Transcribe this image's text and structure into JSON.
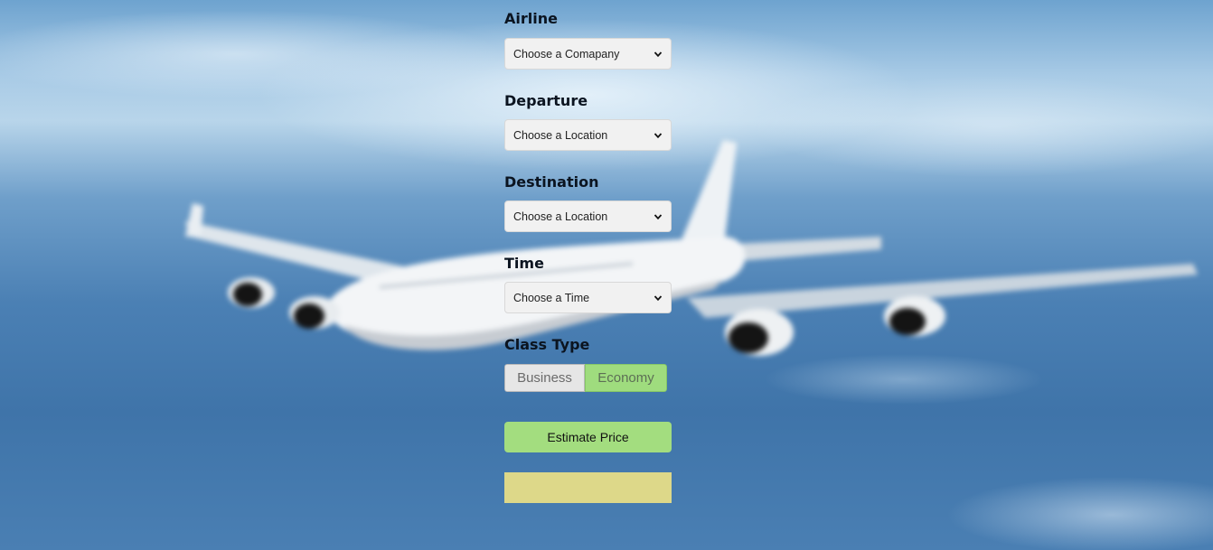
{
  "form": {
    "airline": {
      "label": "Airline",
      "selected": "Choose a Comapany"
    },
    "departure": {
      "label": "Departure",
      "selected": "Choose a Location"
    },
    "destination": {
      "label": "Destination",
      "selected": "Choose a Location"
    },
    "time": {
      "label": "Time",
      "selected": "Choose a Time"
    },
    "class_type": {
      "label": "Class Type",
      "options": [
        "Business",
        "Economy"
      ],
      "selected": "Economy"
    },
    "estimate_button_label": "Estimate Price",
    "result_text": ""
  },
  "colors": {
    "selected_class": "#9fdc7e",
    "estimate_button": "#a3dd7f",
    "result_box": "#ddd889"
  },
  "icons": {
    "dropdown": "chevron-down-icon"
  }
}
